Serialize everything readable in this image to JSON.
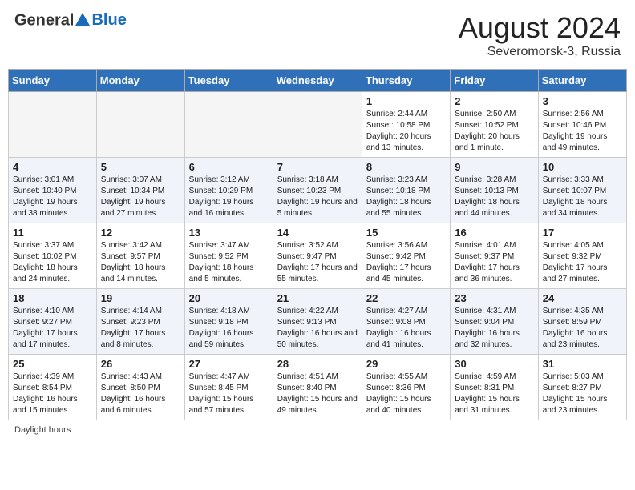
{
  "header": {
    "logo_general": "General",
    "logo_blue": "Blue",
    "month_year": "August 2024",
    "location": "Severomorsk-3, Russia"
  },
  "days_of_week": [
    "Sunday",
    "Monday",
    "Tuesday",
    "Wednesday",
    "Thursday",
    "Friday",
    "Saturday"
  ],
  "footer": {
    "daylight_hours": "Daylight hours"
  },
  "weeks": [
    [
      {
        "day": "",
        "info": ""
      },
      {
        "day": "",
        "info": ""
      },
      {
        "day": "",
        "info": ""
      },
      {
        "day": "",
        "info": ""
      },
      {
        "day": "1",
        "info": "Sunrise: 2:44 AM\nSunset: 10:58 PM\nDaylight: 20 hours\nand 13 minutes."
      },
      {
        "day": "2",
        "info": "Sunrise: 2:50 AM\nSunset: 10:52 PM\nDaylight: 20 hours\nand 1 minute."
      },
      {
        "day": "3",
        "info": "Sunrise: 2:56 AM\nSunset: 10:46 PM\nDaylight: 19 hours\nand 49 minutes."
      }
    ],
    [
      {
        "day": "4",
        "info": "Sunrise: 3:01 AM\nSunset: 10:40 PM\nDaylight: 19 hours\nand 38 minutes."
      },
      {
        "day": "5",
        "info": "Sunrise: 3:07 AM\nSunset: 10:34 PM\nDaylight: 19 hours\nand 27 minutes."
      },
      {
        "day": "6",
        "info": "Sunrise: 3:12 AM\nSunset: 10:29 PM\nDaylight: 19 hours\nand 16 minutes."
      },
      {
        "day": "7",
        "info": "Sunrise: 3:18 AM\nSunset: 10:23 PM\nDaylight: 19 hours\nand 5 minutes."
      },
      {
        "day": "8",
        "info": "Sunrise: 3:23 AM\nSunset: 10:18 PM\nDaylight: 18 hours\nand 55 minutes."
      },
      {
        "day": "9",
        "info": "Sunrise: 3:28 AM\nSunset: 10:13 PM\nDaylight: 18 hours\nand 44 minutes."
      },
      {
        "day": "10",
        "info": "Sunrise: 3:33 AM\nSunset: 10:07 PM\nDaylight: 18 hours\nand 34 minutes."
      }
    ],
    [
      {
        "day": "11",
        "info": "Sunrise: 3:37 AM\nSunset: 10:02 PM\nDaylight: 18 hours\nand 24 minutes."
      },
      {
        "day": "12",
        "info": "Sunrise: 3:42 AM\nSunset: 9:57 PM\nDaylight: 18 hours\nand 14 minutes."
      },
      {
        "day": "13",
        "info": "Sunrise: 3:47 AM\nSunset: 9:52 PM\nDaylight: 18 hours\nand 5 minutes."
      },
      {
        "day": "14",
        "info": "Sunrise: 3:52 AM\nSunset: 9:47 PM\nDaylight: 17 hours\nand 55 minutes."
      },
      {
        "day": "15",
        "info": "Sunrise: 3:56 AM\nSunset: 9:42 PM\nDaylight: 17 hours\nand 45 minutes."
      },
      {
        "day": "16",
        "info": "Sunrise: 4:01 AM\nSunset: 9:37 PM\nDaylight: 17 hours\nand 36 minutes."
      },
      {
        "day": "17",
        "info": "Sunrise: 4:05 AM\nSunset: 9:32 PM\nDaylight: 17 hours\nand 27 minutes."
      }
    ],
    [
      {
        "day": "18",
        "info": "Sunrise: 4:10 AM\nSunset: 9:27 PM\nDaylight: 17 hours\nand 17 minutes."
      },
      {
        "day": "19",
        "info": "Sunrise: 4:14 AM\nSunset: 9:23 PM\nDaylight: 17 hours\nand 8 minutes."
      },
      {
        "day": "20",
        "info": "Sunrise: 4:18 AM\nSunset: 9:18 PM\nDaylight: 16 hours\nand 59 minutes."
      },
      {
        "day": "21",
        "info": "Sunrise: 4:22 AM\nSunset: 9:13 PM\nDaylight: 16 hours\nand 50 minutes."
      },
      {
        "day": "22",
        "info": "Sunrise: 4:27 AM\nSunset: 9:08 PM\nDaylight: 16 hours\nand 41 minutes."
      },
      {
        "day": "23",
        "info": "Sunrise: 4:31 AM\nSunset: 9:04 PM\nDaylight: 16 hours\nand 32 minutes."
      },
      {
        "day": "24",
        "info": "Sunrise: 4:35 AM\nSunset: 8:59 PM\nDaylight: 16 hours\nand 23 minutes."
      }
    ],
    [
      {
        "day": "25",
        "info": "Sunrise: 4:39 AM\nSunset: 8:54 PM\nDaylight: 16 hours\nand 15 minutes."
      },
      {
        "day": "26",
        "info": "Sunrise: 4:43 AM\nSunset: 8:50 PM\nDaylight: 16 hours\nand 6 minutes."
      },
      {
        "day": "27",
        "info": "Sunrise: 4:47 AM\nSunset: 8:45 PM\nDaylight: 15 hours\nand 57 minutes."
      },
      {
        "day": "28",
        "info": "Sunrise: 4:51 AM\nSunset: 8:40 PM\nDaylight: 15 hours\nand 49 minutes."
      },
      {
        "day": "29",
        "info": "Sunrise: 4:55 AM\nSunset: 8:36 PM\nDaylight: 15 hours\nand 40 minutes."
      },
      {
        "day": "30",
        "info": "Sunrise: 4:59 AM\nSunset: 8:31 PM\nDaylight: 15 hours\nand 31 minutes."
      },
      {
        "day": "31",
        "info": "Sunrise: 5:03 AM\nSunset: 8:27 PM\nDaylight: 15 hours\nand 23 minutes."
      }
    ]
  ]
}
